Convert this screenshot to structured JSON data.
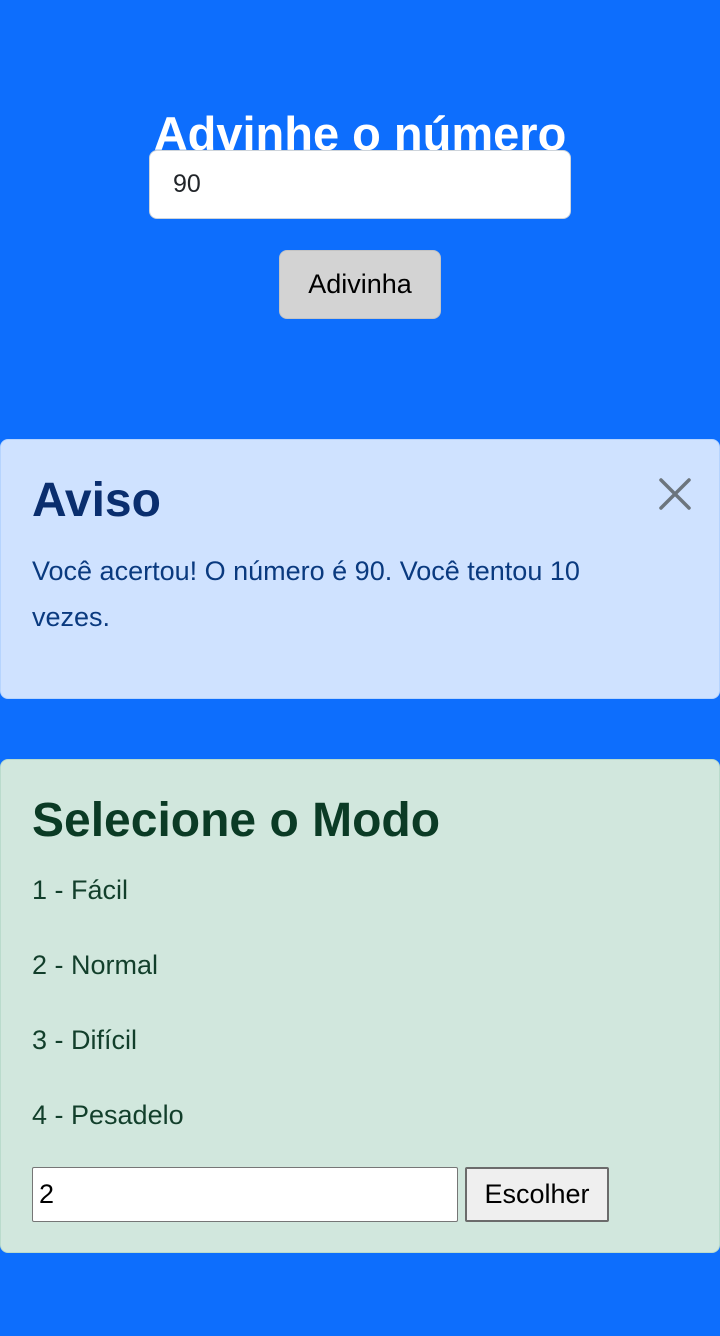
{
  "game": {
    "title": "Advinhe o número",
    "guess_value": "90",
    "guess_button_label": "Adivinha"
  },
  "alert": {
    "title": "Aviso",
    "message": "Você acertou! O número é 90. Você tentou 10 vezes.",
    "close_icon": "close-icon"
  },
  "mode": {
    "title": "Selecione o Modo",
    "options": [
      {
        "label": "1 - Fácil"
      },
      {
        "label": "2 - Normal"
      },
      {
        "label": "3 - Difícil"
      },
      {
        "label": "4 - Pesadelo"
      }
    ],
    "input_value": "2",
    "button_label": "Escolher"
  },
  "colors": {
    "background": "#0d6efd",
    "alert_background": "#cfe2ff",
    "mode_background": "#d1e7dd"
  }
}
